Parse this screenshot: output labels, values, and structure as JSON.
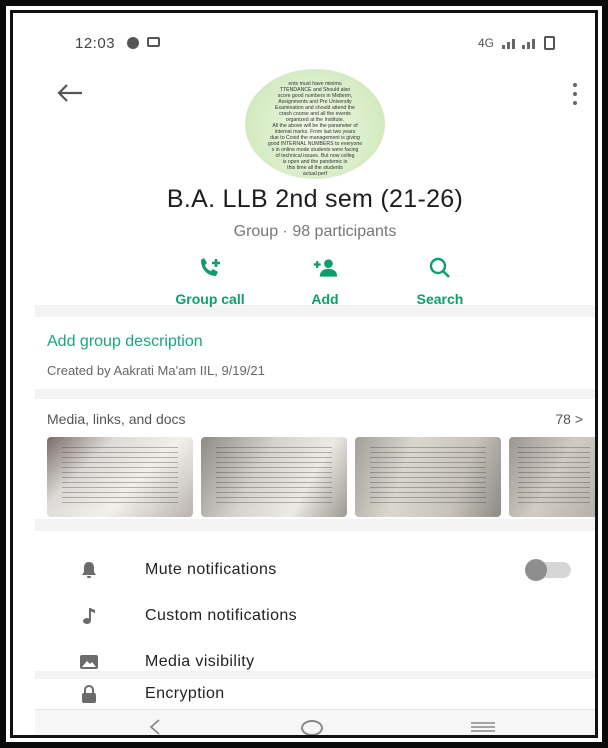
{
  "status_bar": {
    "time": "12:03",
    "network": "4G"
  },
  "header": {
    "title": "B.A. LLB 2nd sem (21-26)",
    "subtitle": "Group · 98 participants",
    "avatar_text": [
      "ents must have minimu",
      "TTENDANCE and Should also",
      "score good numbers in Midterm,",
      "Assignments and Pre University",
      "Examination and should attend the",
      "crash course and all the events",
      "organized at the Institute.",
      "All the above will be the parameter of",
      "internal marks. From last two years",
      "due to Covid the management is giving",
      "good INTERNAL NUMBERS to everyone",
      "s in online mode students were facing",
      "of technical issues. But now colleg",
      "is open and the pandemic is",
      "this time all the students",
      "actual perf"
    ]
  },
  "actions": [
    {
      "label": "Group call",
      "icon": "group-call-icon"
    },
    {
      "label": "Add",
      "icon": "add-participant-icon"
    },
    {
      "label": "Search",
      "icon": "search-icon"
    }
  ],
  "description": {
    "link": "Add group description",
    "created": "Created by Aakrati Ma'am IIL, 9/19/21"
  },
  "media": {
    "header": "Media, links, and docs",
    "count": "78 >"
  },
  "settings": [
    {
      "label": "Mute notifications",
      "icon": "bell-icon"
    },
    {
      "label": "Custom notifications",
      "icon": "music-note-icon"
    },
    {
      "label": "Media visibility",
      "icon": "image-icon"
    }
  ],
  "encryption": {
    "label": "Encryption",
    "icon": "lock-icon"
  },
  "colors": {
    "accent": "#0f9d6e",
    "link": "#1aa57d"
  }
}
